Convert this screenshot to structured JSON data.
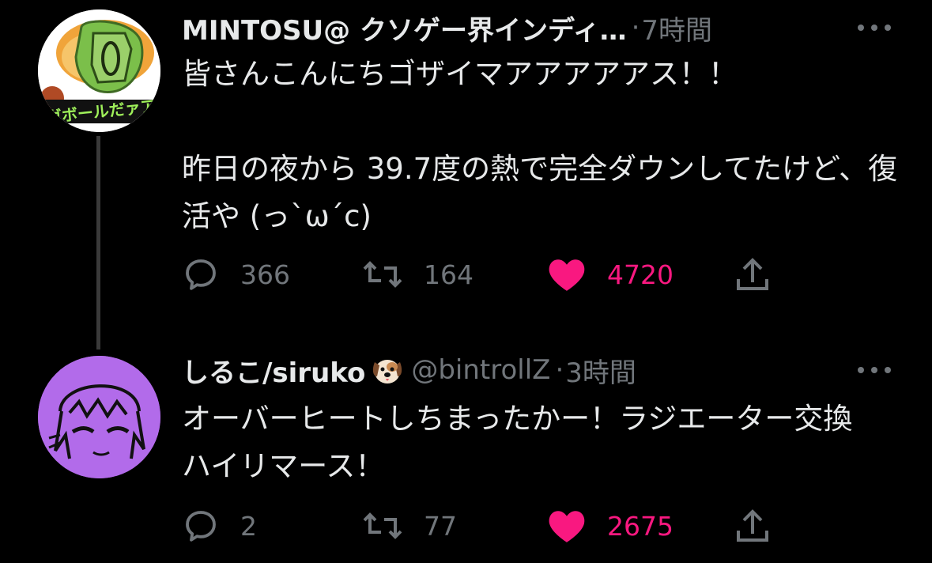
{
  "tweets": [
    {
      "author": {
        "name": "MINTOSU@ クソゲー界インディ…",
        "handle": "",
        "avatar_icon": "mintosu-avatar-icon"
      },
      "time": "7時間",
      "separator": "·",
      "text": "皆さんこんにちゴザイマアアアアアス！！\n\n昨日の夜から 39.7度の熱で完全ダウンしてたけど、復活や (っ`ω´c)",
      "avatar_text": "ガボールだァア",
      "stats": {
        "replies": "366",
        "retweets": "164",
        "likes": "4720"
      }
    },
    {
      "author": {
        "name": "しるこ/siruko",
        "name_emoji": "dog-face-icon",
        "handle": "@bintrollZ",
        "avatar_icon": "siruko-avatar-icon"
      },
      "time": "3時間",
      "separator": "·",
      "text": "オーバーヒートしちまったかー！ラジエーター交換ハイリマース！",
      "stats": {
        "replies": "2",
        "retweets": "77",
        "likes": "2675"
      }
    }
  ],
  "colors": {
    "background": "#000000",
    "text": "#e7e9ea",
    "secondary": "#71767b",
    "like": "#f91880",
    "thread_line": "#3a3a3a",
    "avatar2_bg": "#b26bea"
  }
}
